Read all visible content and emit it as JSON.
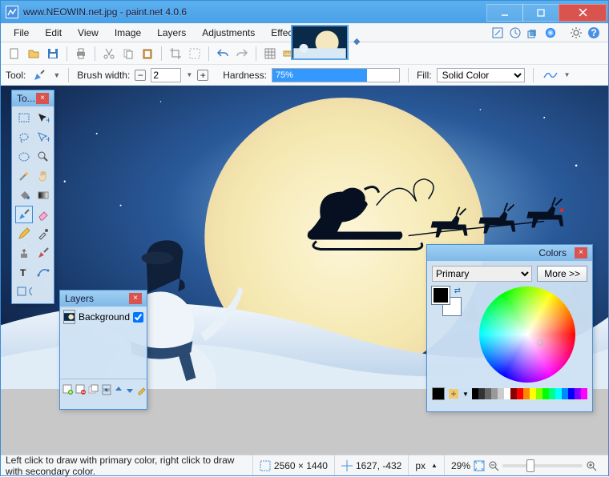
{
  "title": "www.NEOWIN.net.jpg - paint.net 4.0.6",
  "menu": {
    "file": "File",
    "edit": "Edit",
    "view": "View",
    "image": "Image",
    "layers": "Layers",
    "adjustments": "Adjustments",
    "effects": "Effects"
  },
  "tool_options": {
    "tool_label": "Tool:",
    "brush_width_label": "Brush width:",
    "brush_width": "2",
    "hardness_label": "Hardness:",
    "hardness": "75%",
    "fill_label": "Fill:",
    "fill_value": "Solid Color"
  },
  "panels": {
    "tools_title": "To...",
    "layers_title": "Layers",
    "colors_title": "Colors"
  },
  "layers": {
    "items": [
      {
        "name": "Background",
        "visible": true
      }
    ]
  },
  "colors": {
    "dropdown": "Primary",
    "more": "More >>"
  },
  "status": {
    "hint": "Left click to draw with primary color, right click to draw with secondary color.",
    "dims": "2560 × 1440",
    "cursor": "1627, -432",
    "unit": "px",
    "zoom": "29%"
  },
  "palette": [
    "#000",
    "#333",
    "#666",
    "#999",
    "#ccc",
    "#fff",
    "#800",
    "#f00",
    "#f80",
    "#ff0",
    "#8f0",
    "#0f0",
    "#0f8",
    "#0ff",
    "#08f",
    "#00f",
    "#80f",
    "#f0f"
  ]
}
